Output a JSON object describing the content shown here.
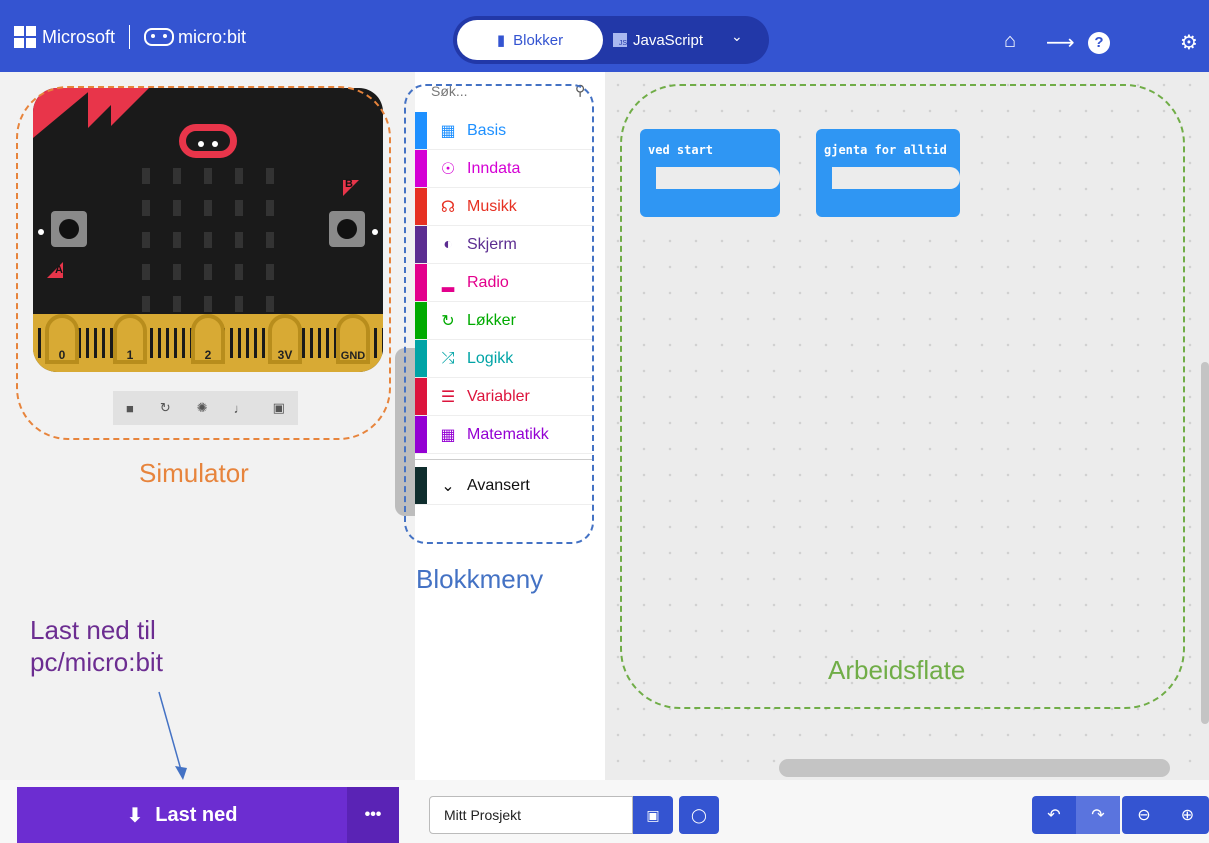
{
  "header": {
    "brand_left": "Microsoft",
    "brand_right": "micro:bit",
    "mode_blocks": "Blokker",
    "mode_js": "JavaScript",
    "js_badge": "JS",
    "icons": [
      "home-icon",
      "share-icon",
      "help-icon",
      "settings-icon"
    ]
  },
  "simulator": {
    "pins": [
      "0",
      "1",
      "2",
      "3V",
      "GND"
    ],
    "button_a": "A",
    "button_b": "B",
    "controls": [
      "stop-icon",
      "restart-icon",
      "debug-icon",
      "sound-icon",
      "fullscreen-icon"
    ]
  },
  "toolbox": {
    "search_placeholder": "Søk...",
    "categories": [
      {
        "label": "Basis",
        "color": "#1E90FF"
      },
      {
        "label": "Inndata",
        "color": "#D400D4"
      },
      {
        "label": "Musikk",
        "color": "#E63022"
      },
      {
        "label": "Skjerm",
        "color": "#5C2D91"
      },
      {
        "label": "Radio",
        "color": "#E3008C"
      },
      {
        "label": "Løkker",
        "color": "#00AA00"
      },
      {
        "label": "Logikk",
        "color": "#00A4A6"
      },
      {
        "label": "Variabler",
        "color": "#DC143C"
      },
      {
        "label": "Matematikk",
        "color": "#9400D3"
      },
      {
        "label": "Avansert",
        "color": "#0F2D2D"
      }
    ]
  },
  "workspace": {
    "blocks": [
      "ved start",
      "gjenta for alltid"
    ]
  },
  "annotations": {
    "simulator": "Simulator",
    "toolbox": "Blokkmeny",
    "workspace": "Arbeidsflate",
    "download_line1": "Last ned til",
    "download_line2": "pc/micro:bit"
  },
  "bottom": {
    "download_label": "Last ned",
    "more_label": "•••",
    "project_name": "Mitt Prosjekt"
  },
  "colors": {
    "header": "#3454D1",
    "download": "#6C2DD1",
    "block": "#2F96F3",
    "sim_note": "#E7843C",
    "toolbox_note": "#4472C4",
    "workspace_note": "#70AD47",
    "download_note": "#6C2D91"
  }
}
